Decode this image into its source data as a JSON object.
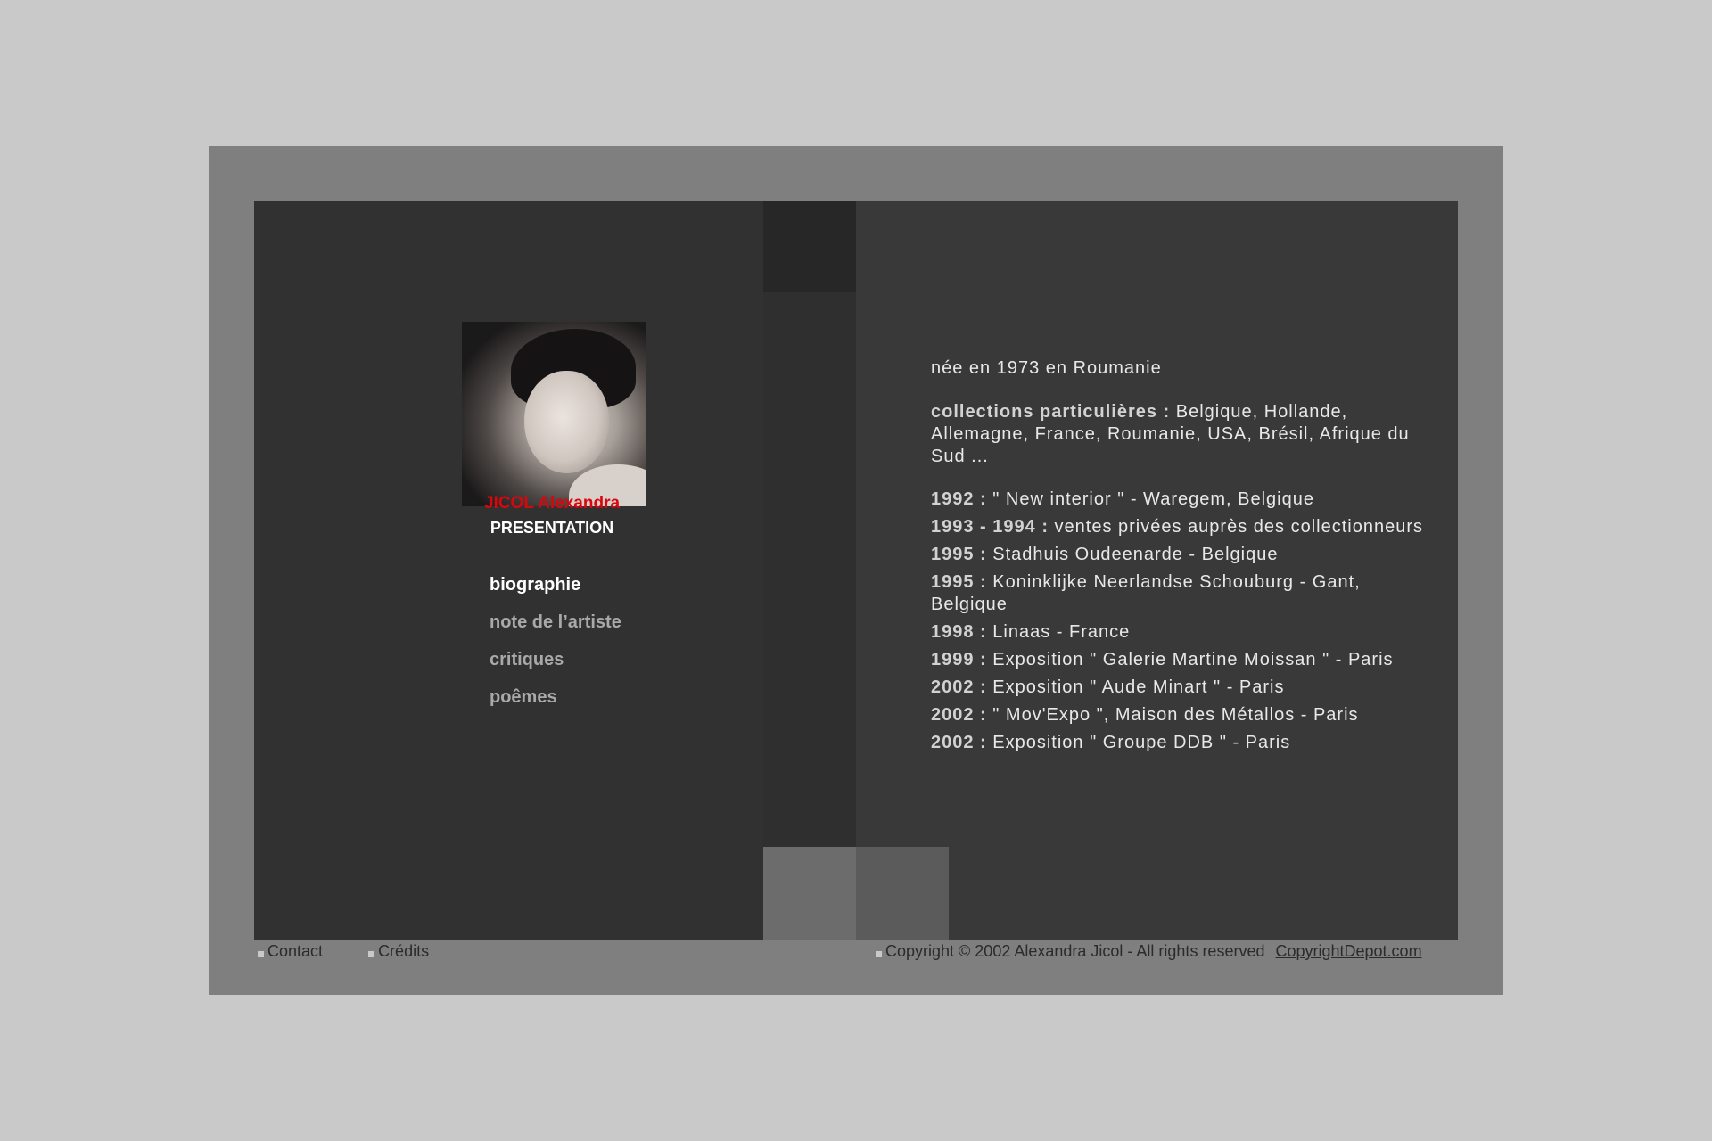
{
  "artist": {
    "name": "JICOL Alexandra",
    "section": "PRESENTATION"
  },
  "menu": {
    "items": [
      {
        "label": "biographie"
      },
      {
        "label": "note de l’artiste"
      },
      {
        "label": "critiques"
      },
      {
        "label": "poêmes"
      }
    ]
  },
  "bio": {
    "birth": "née en 1973 en Roumanie",
    "collections_label": "collections particulières :",
    "collections_text": " Belgique, Hollande, Allemagne, France, Roumanie, USA, Brésil, Afrique du Sud ...",
    "entries": [
      {
        "year": "1992 :",
        "text": " \" New interior \" - Waregem, Belgique"
      },
      {
        "year": "1993 - 1994 :",
        "text": " ventes privées auprès des collectionneurs"
      },
      {
        "year": "1995 :",
        "text": " Stadhuis Oudeenarde - Belgique"
      },
      {
        "year": "1995 :",
        "text": " Koninklijke Neerlandse Schouburg - Gant, Belgique"
      },
      {
        "year": "1998 :",
        "text": " Linaas - France"
      },
      {
        "year": "1999 :",
        "text": " Exposition \" Galerie Martine Moissan \" - Paris"
      },
      {
        "year": "2002 :",
        "text": " Exposition \" Aude Minart \" - Paris"
      },
      {
        "year": "2002 :",
        "text": " \" Mov'Expo \", Maison des Métallos - Paris"
      },
      {
        "year": "2002 :",
        "text": " Exposition \" Groupe DDB \" - Paris"
      }
    ]
  },
  "footer": {
    "contact": "Contact",
    "credits": "Crédits",
    "copyright": "Copyright © 2002 Alexandra Jicol - All rights reserved",
    "copyright_link": "CopyrightDepot.com"
  }
}
